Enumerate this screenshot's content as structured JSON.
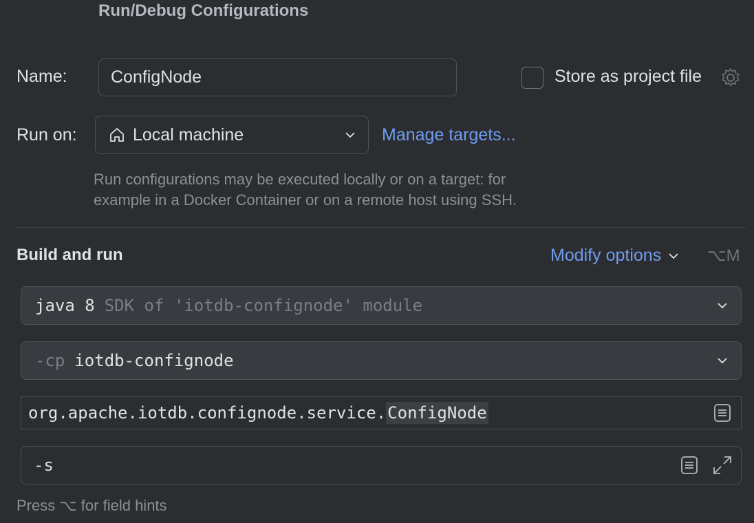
{
  "dialog": {
    "title": "Run/Debug Configurations"
  },
  "name": {
    "label": "Name:",
    "value": "ConfigNode"
  },
  "store": {
    "label": "Store as project file",
    "checked": false
  },
  "run_on": {
    "label": "Run on:",
    "value": "Local machine",
    "manage_link": "Manage targets..."
  },
  "hint": {
    "line1": "Run configurations may be executed locally or on a target: for",
    "line2": "example in a Docker Container or on a remote host using SSH."
  },
  "build": {
    "title": "Build and run",
    "modify_options": "Modify options",
    "shortcut": "⌥M",
    "jdk": {
      "name": "java 8",
      "desc": "SDK of 'iotdb-confignode' module"
    },
    "classpath": {
      "prefix": "-cp",
      "module": "iotdb-confignode"
    },
    "main_class": {
      "package": "org.apache.iotdb.confignode.service.",
      "class": "ConfigNode"
    },
    "program_args": "-s"
  },
  "footer": {
    "hint": "Press ⌥ for field hints"
  },
  "colors": {
    "background": "#2b2d30",
    "link": "#6f9cf0",
    "border": "#4e5157",
    "combo_bg": "#393b40"
  }
}
